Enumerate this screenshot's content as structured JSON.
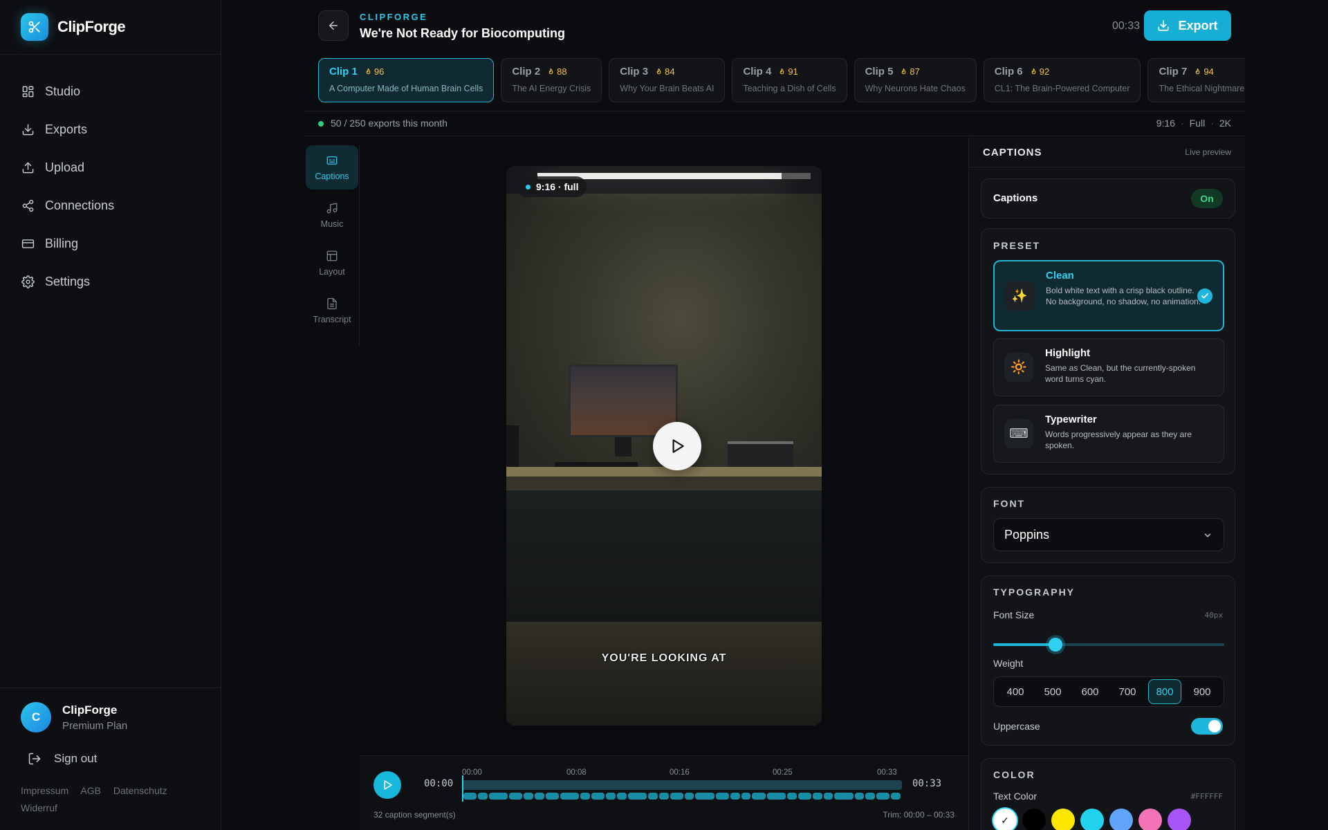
{
  "brand": {
    "name": "ClipForge"
  },
  "nav": [
    {
      "label": "Studio",
      "icon": "grid-icon"
    },
    {
      "label": "Exports",
      "icon": "download-icon"
    },
    {
      "label": "Upload",
      "icon": "upload-icon"
    },
    {
      "label": "Connections",
      "icon": "share-icon"
    },
    {
      "label": "Billing",
      "icon": "card-icon"
    },
    {
      "label": "Settings",
      "icon": "gear-icon"
    }
  ],
  "user": {
    "initial": "C",
    "name": "ClipForge",
    "plan": "Premium Plan",
    "signout_label": "Sign out"
  },
  "legal": {
    "impressum": "Impressum",
    "agb": "AGB",
    "datenschutz": "Datenschutz",
    "widerruf": "Widerruf"
  },
  "header": {
    "eyebrow": "CLIPFORGE",
    "title": "We're Not Ready for Biocomputing",
    "duration": "00:33",
    "export_label": "Export"
  },
  "clips": [
    {
      "name": "Clip 1",
      "score": "96",
      "subtitle": "A Computer Made of Human Brain Cells",
      "active": true
    },
    {
      "name": "Clip 2",
      "score": "88",
      "subtitle": "The AI Energy Crisis"
    },
    {
      "name": "Clip 3",
      "score": "84",
      "subtitle": "Why Your Brain Beats AI"
    },
    {
      "name": "Clip 4",
      "score": "91",
      "subtitle": "Teaching a Dish of Cells"
    },
    {
      "name": "Clip 5",
      "score": "87",
      "subtitle": "Why Neurons Hate Chaos"
    },
    {
      "name": "Clip 6",
      "score": "92",
      "subtitle": "CL1: The Brain-Powered Computer"
    },
    {
      "name": "Clip 7",
      "score": "94",
      "subtitle": "The Ethical Nightmare"
    }
  ],
  "infobar": {
    "quota": "50 / 250 exports this month",
    "aspect": "9:16",
    "mode": "Full",
    "resolution": "2K"
  },
  "rail": [
    {
      "label": "Captions",
      "icon": "captions-icon",
      "active": true
    },
    {
      "label": "Music",
      "icon": "music-icon"
    },
    {
      "label": "Layout",
      "icon": "layout-icon"
    },
    {
      "label": "Transcript",
      "icon": "transcript-icon"
    }
  ],
  "preview": {
    "badge": "9:16 · full",
    "caption": "YOU'RE LOOKING AT"
  },
  "timeline": {
    "start": "00:00",
    "end": "00:33",
    "ticks": [
      "00:00",
      "00:08",
      "00:16",
      "00:25",
      "00:33"
    ],
    "segments_label": "32 caption segment(s)",
    "trim_label": "Trim: 00:00 – 00:33",
    "segment_count": 32
  },
  "panel": {
    "title": "CAPTIONS",
    "live": "Live preview",
    "captions_toggle": {
      "label": "Captions",
      "state": "On"
    },
    "preset": {
      "label": "PRESET",
      "items": [
        {
          "name": "Clean",
          "icon": "sparkles-icon",
          "glyph": "✨",
          "desc": "Bold white text with a crisp black outline. No background, no shadow, no animation.",
          "active": true
        },
        {
          "name": "Highlight",
          "icon": "sun-icon",
          "glyph": "🔆",
          "desc": "Same as Clean, but the currently-spoken word turns cyan."
        },
        {
          "name": "Typewriter",
          "icon": "keyboard-icon",
          "glyph": "⌨",
          "desc": "Words progressively appear as they are spoken."
        }
      ]
    },
    "font": {
      "label": "FONT",
      "value": "Poppins"
    },
    "typography": {
      "label": "TYPOGRAPHY",
      "font_size_label": "Font Size",
      "font_size_value": "40px",
      "font_size_fraction": 0.27,
      "weight_label": "Weight",
      "weights": [
        "400",
        "500",
        "600",
        "700",
        "800",
        "900"
      ],
      "weight_active": "800",
      "uppercase_label": "Uppercase",
      "uppercase_on": true
    },
    "color": {
      "label": "COLOR",
      "text_color_label": "Text Color",
      "text_color_value": "#FFFFFF",
      "swatches": [
        "#FFFFFF",
        "#000000",
        "#FFE600",
        "#22D3EE",
        "#60A5FA",
        "#F472B6",
        "#A855F7"
      ]
    }
  },
  "colors": {
    "accent": "#1FB6DC",
    "success": "#2FD07C",
    "score": "#F5C24A"
  }
}
